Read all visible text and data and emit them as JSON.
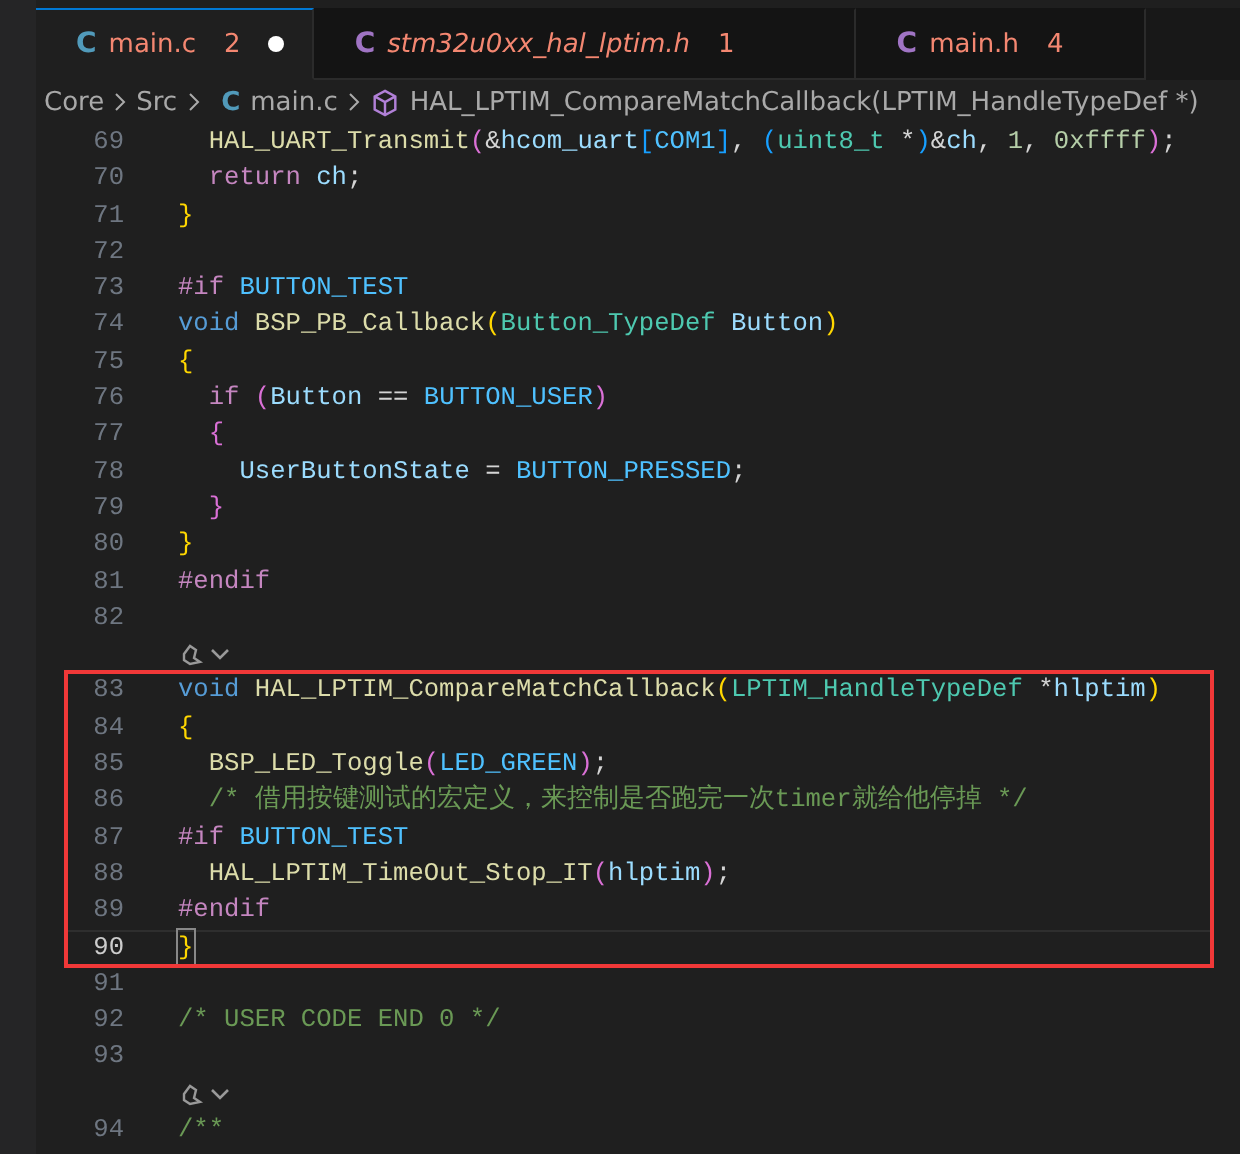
{
  "tabs": [
    {
      "icon": "C",
      "label": "main.c",
      "problems": "2",
      "selected": true,
      "dirty": true,
      "preview": false
    },
    {
      "icon": "C",
      "label": "stm32u0xx_hal_lptim.h",
      "problems": "1",
      "selected": false,
      "dirty": false,
      "preview": true
    },
    {
      "icon": "C",
      "label": "main.h",
      "problems": "4",
      "selected": false,
      "dirty": false,
      "preview": false
    }
  ],
  "breadcrumb": {
    "folders": [
      "Core",
      "Src"
    ],
    "file_icon": "C",
    "file": "main.c",
    "symbol": "HAL_LPTIM_CompareMatchCallback(LPTIM_HandleTypeDef *)"
  },
  "editor": {
    "blocks": [
      {
        "highlighted": false,
        "lines": [
          {
            "kind": "code",
            "number": "69",
            "current": false,
            "text": "  HAL_UART_Transmit(&hcom_uart[COM1], (uint8_t *)&ch, 1, 0xffff);"
          },
          {
            "kind": "code",
            "number": "70",
            "current": false,
            "text": "  return ch;"
          },
          {
            "kind": "code",
            "number": "71",
            "current": false,
            "text": "}"
          },
          {
            "kind": "code",
            "number": "72",
            "current": false
          },
          {
            "kind": "code",
            "number": "73",
            "current": false,
            "text": "#if BUTTON_TEST"
          },
          {
            "kind": "code",
            "number": "74",
            "current": false,
            "text": "void BSP_PB_Callback(Button_TypeDef Button)"
          },
          {
            "kind": "code",
            "number": "75",
            "current": false,
            "text": "{"
          },
          {
            "kind": "code",
            "number": "76",
            "current": false,
            "text": "  if (Button == BUTTON_USER)"
          },
          {
            "kind": "code",
            "number": "77",
            "current": false,
            "text": "  {"
          },
          {
            "kind": "code",
            "number": "78",
            "current": false,
            "text": "    UserButtonState = BUTTON_PRESSED;"
          },
          {
            "kind": "code",
            "number": "79",
            "current": false,
            "text": "  }"
          },
          {
            "kind": "code",
            "number": "80",
            "current": false,
            "text": "}"
          },
          {
            "kind": "code",
            "number": "81",
            "current": false,
            "text": "#endif"
          },
          {
            "kind": "code",
            "number": "82",
            "current": false
          },
          {
            "kind": "lens"
          }
        ]
      },
      {
        "highlighted": true,
        "lines": [
          {
            "kind": "code",
            "number": "83",
            "current": false,
            "text": "void HAL_LPTIM_CompareMatchCallback(LPTIM_HandleTypeDef *hlptim)"
          },
          {
            "kind": "code",
            "number": "84",
            "current": false,
            "text": "{"
          },
          {
            "kind": "code",
            "number": "85",
            "current": false,
            "text": "  BSP_LED_Toggle(LED_GREEN);"
          },
          {
            "kind": "code",
            "number": "86",
            "current": false,
            "text": "  /* 借用按键测试的宏定义，来控制是否跑完一次timer就给他停掉 */"
          },
          {
            "kind": "code",
            "number": "87",
            "current": false,
            "text": "#if BUTTON_TEST"
          },
          {
            "kind": "code",
            "number": "88",
            "current": false,
            "text": "  HAL_LPTIM_TimeOut_Stop_IT(hlptim);"
          },
          {
            "kind": "code",
            "number": "89",
            "current": false,
            "text": "#endif"
          },
          {
            "kind": "code",
            "number": "90",
            "current": true,
            "text": "}"
          }
        ]
      },
      {
        "highlighted": false,
        "lines": [
          {
            "kind": "code",
            "number": "91",
            "current": false
          },
          {
            "kind": "code",
            "number": "92",
            "current": false,
            "text": "/* USER CODE END 0 */"
          },
          {
            "kind": "code",
            "number": "93",
            "current": false
          },
          {
            "kind": "lens"
          },
          {
            "kind": "code",
            "number": "94",
            "current": false,
            "text": "/**"
          }
        ]
      }
    ]
  }
}
